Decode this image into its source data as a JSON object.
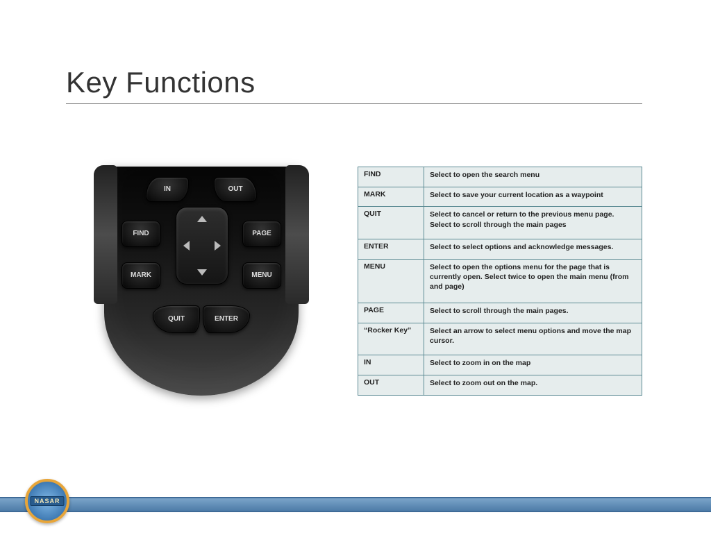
{
  "title": "Key Functions",
  "device_buttons": {
    "in": "IN",
    "out": "OUT",
    "find": "FIND",
    "page": "PAGE",
    "mark": "MARK",
    "menu": "MENU",
    "quit": "QUIT",
    "enter": "ENTER"
  },
  "rows": [
    {
      "key": "FIND",
      "desc": "Select to open the search menu"
    },
    {
      "key": "MARK",
      "desc": "Select to save your current location as a waypoint"
    },
    {
      "key": "QUIT",
      "desc": "Select to cancel or return to the previous menu page.\nSelect to scroll through the main pages"
    },
    {
      "key": "ENTER",
      "desc": "Select to select options and acknowledge messages."
    },
    {
      "key": "MENU",
      "desc": "Select to open the options menu for the page that is currently open.\nSelect twice to open the main menu (from and page)"
    },
    {
      "key": "PAGE",
      "desc": "Select to scroll through the main pages."
    },
    {
      "key": "“Rocker Key”",
      "desc": "Select an arrow to select menu options and move the map cursor."
    },
    {
      "key": "IN",
      "desc": "Select to zoom in on the map"
    },
    {
      "key": "OUT",
      "desc": "Select to zoom out on the map."
    }
  ],
  "logo_text": "NASAR"
}
